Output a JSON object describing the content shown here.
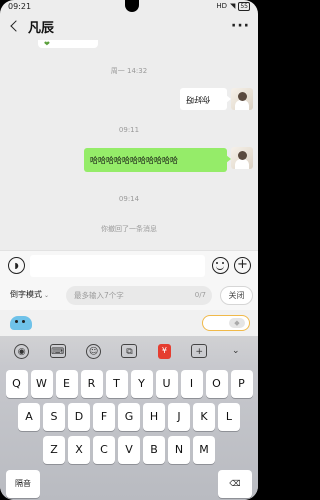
{
  "status": {
    "time": "09:21",
    "signal": "HD",
    "battery": "55"
  },
  "header": {
    "title": "凡辰",
    "more": "···"
  },
  "chat": {
    "cut_bubble_text": "❤",
    "timestamps": [
      "周一 14:32",
      "09:11",
      "09:14"
    ],
    "messages": [
      {
        "side": "right",
        "color": "white",
        "text": "你好呀",
        "flipped": true
      },
      {
        "side": "right",
        "color": "green",
        "text": "哈哈哈哈哈哈哈哈哈哈哈"
      }
    ],
    "recall_notice": "你撤回了一条消息"
  },
  "input_bar": {
    "voice_icon": "voice-icon",
    "input_value": "",
    "emoji_icon": "emoji-icon",
    "plus_icon": "plus-icon"
  },
  "mode_bar": {
    "mode_label": "倒字模式",
    "caret": "⌄",
    "placeholder": "最多输入7个字",
    "counter": "0/7",
    "close_label": "关闭"
  },
  "keyboard": {
    "tools": [
      "owl-icon",
      "keyboard-icon",
      "emoji-icon",
      "gif-icon",
      "red-envelope-icon",
      "folder-plus-icon",
      "collapse-icon"
    ],
    "tool_labels": [
      "◉",
      "⌨",
      "☺",
      "⧉",
      "¥",
      "+",
      "⌄"
    ],
    "row1": [
      "Q",
      "W",
      "E",
      "R",
      "T",
      "Y",
      "U",
      "I",
      "O",
      "P"
    ],
    "row2": [
      "A",
      "S",
      "D",
      "F",
      "G",
      "H",
      "J",
      "K",
      "L"
    ],
    "row3": [
      "Z",
      "X",
      "C",
      "V",
      "B",
      "N",
      "M"
    ],
    "row4": {
      "left": "隔音",
      "right": "⌫"
    }
  }
}
